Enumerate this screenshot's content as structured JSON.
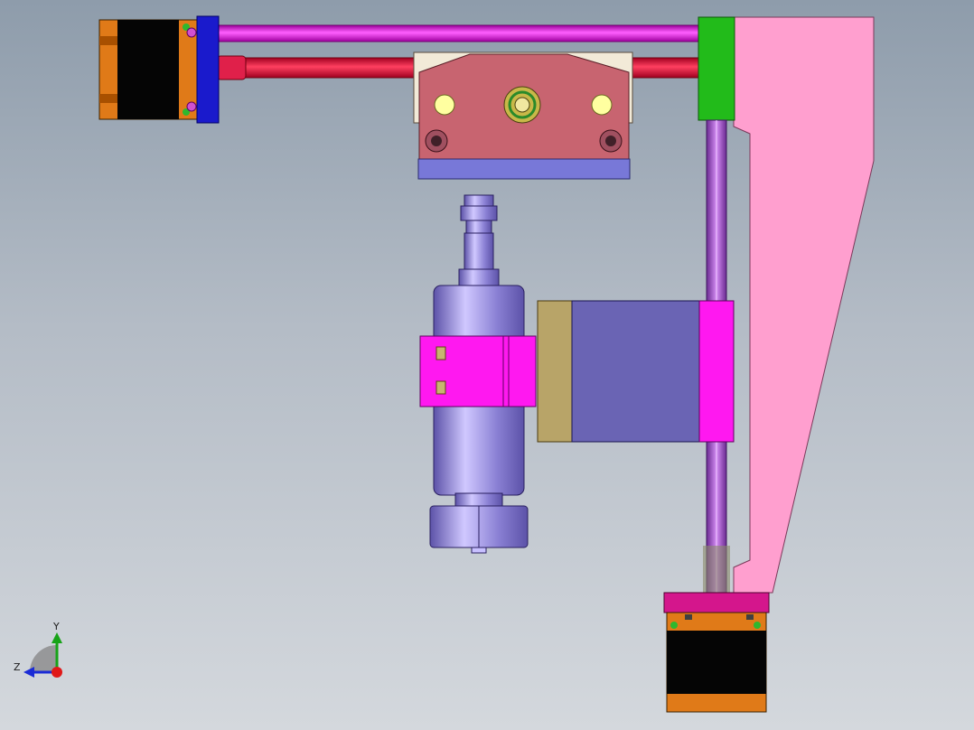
{
  "scene": {
    "background_top": "#8e9cab",
    "background_bottom": "#d4d8dd"
  },
  "colors": {
    "motor_body": "#050505",
    "motor_accent": "#e07a18",
    "x_rod_upper": "#ff20ff",
    "x_rod_lower": "#e8123a",
    "left_end_plate": "#1a1acc",
    "right_end_block": "#22bb1a",
    "side_frame": "#ff9fcf",
    "carriage_top": "#c86470",
    "carriage_base": "#7878d8",
    "spindle_body": "#9b8fe0",
    "spindle_clamp": "#ff18f0",
    "z_plate": "#6a64b4",
    "z_plate_tan": "#b8a468",
    "z_rod": "#b05ad8",
    "bottom_motor_mount": "#d4168c"
  },
  "triad": {
    "y_label": "Y",
    "z_label": "Z",
    "y_color": "#17a317",
    "z_color": "#1a2bd6",
    "x_color": "#e01818"
  }
}
